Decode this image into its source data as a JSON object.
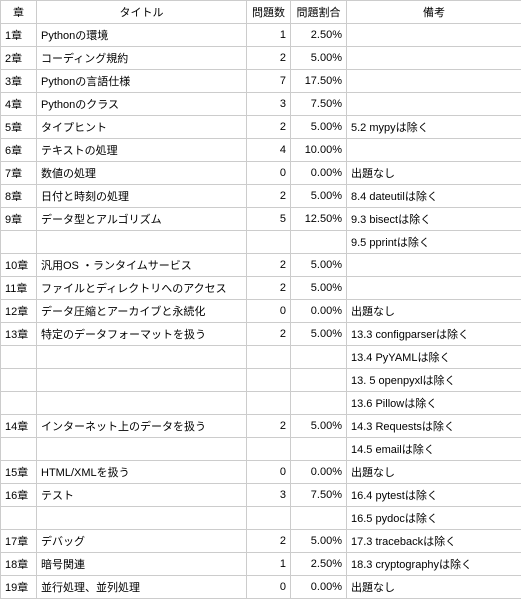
{
  "headers": {
    "chapter": "章",
    "title": "タイトル",
    "count": "問題数",
    "ratio": "問題割合",
    "note": "備考"
  },
  "rows": [
    {
      "chapter": "1章",
      "title": "Pythonの環境",
      "count": "1",
      "ratio": "2.50%",
      "note": ""
    },
    {
      "chapter": "2章",
      "title": "コーディング規約",
      "count": "2",
      "ratio": "5.00%",
      "note": ""
    },
    {
      "chapter": "3章",
      "title": "Pythonの言語仕様",
      "count": "7",
      "ratio": "17.50%",
      "note": ""
    },
    {
      "chapter": "4章",
      "title": "Pythonのクラス",
      "count": "3",
      "ratio": "7.50%",
      "note": ""
    },
    {
      "chapter": "5章",
      "title": "タイプヒント",
      "count": "2",
      "ratio": "5.00%",
      "note": "5.2 mypyは除く"
    },
    {
      "chapter": "6章",
      "title": "テキストの処理",
      "count": "4",
      "ratio": "10.00%",
      "note": ""
    },
    {
      "chapter": "7章",
      "title": "数値の処理",
      "count": "0",
      "ratio": "0.00%",
      "note": "出題なし"
    },
    {
      "chapter": "8章",
      "title": "日付と時刻の処理",
      "count": "2",
      "ratio": "5.00%",
      "note": "8.4 dateutilは除く"
    },
    {
      "chapter": "9章",
      "title": "データ型とアルゴリズム",
      "count": "5",
      "ratio": "12.50%",
      "note": "9.3 bisectは除く"
    },
    {
      "chapter": "",
      "title": "",
      "count": "",
      "ratio": "",
      "note": "9.5 pprintは除く"
    },
    {
      "chapter": "10章",
      "title": "汎用OS ・ランタイムサービス",
      "count": "2",
      "ratio": "5.00%",
      "note": ""
    },
    {
      "chapter": "11章",
      "title": "ファイルとディレクトリへのアクセス",
      "count": "2",
      "ratio": "5.00%",
      "note": ""
    },
    {
      "chapter": "12章",
      "title": "データ圧縮とアーカイブと永続化",
      "count": "0",
      "ratio": "0.00%",
      "note": "出題なし"
    },
    {
      "chapter": "13章",
      "title": "特定のデータフォーマットを扱う",
      "count": "2",
      "ratio": "5.00%",
      "note": "13.3 configparserは除く"
    },
    {
      "chapter": "",
      "title": "",
      "count": "",
      "ratio": "",
      "note": "13.4 PyYAMLは除く"
    },
    {
      "chapter": "",
      "title": "",
      "count": "",
      "ratio": "",
      "note": "13. 5 openpyxlは除く"
    },
    {
      "chapter": "",
      "title": "",
      "count": "",
      "ratio": "",
      "note": "13.6 Pillowは除く"
    },
    {
      "chapter": "14章",
      "title": "インターネット上のデータを扱う",
      "count": "2",
      "ratio": "5.00%",
      "note": "14.3 Requestsは除く"
    },
    {
      "chapter": "",
      "title": "",
      "count": "",
      "ratio": "",
      "note": "14.5 emailは除く"
    },
    {
      "chapter": "15章",
      "title": "HTML/XMLを扱う",
      "count": "0",
      "ratio": "0.00%",
      "note": "出題なし"
    },
    {
      "chapter": "16章",
      "title": "テスト",
      "count": "3",
      "ratio": "7.50%",
      "note": "16.4 pytestは除く"
    },
    {
      "chapter": "",
      "title": "",
      "count": "",
      "ratio": "",
      "note": "16.5 pydocは除く"
    },
    {
      "chapter": "17章",
      "title": "デバッグ",
      "count": "2",
      "ratio": "5.00%",
      "note": "17.3 tracebackは除く"
    },
    {
      "chapter": "18章",
      "title": "暗号関連",
      "count": "1",
      "ratio": "2.50%",
      "note": "18.3 cryptographyは除く"
    },
    {
      "chapter": "19章",
      "title": "並行処理、並列処理",
      "count": "0",
      "ratio": "0.00%",
      "note": "出題なし"
    }
  ]
}
